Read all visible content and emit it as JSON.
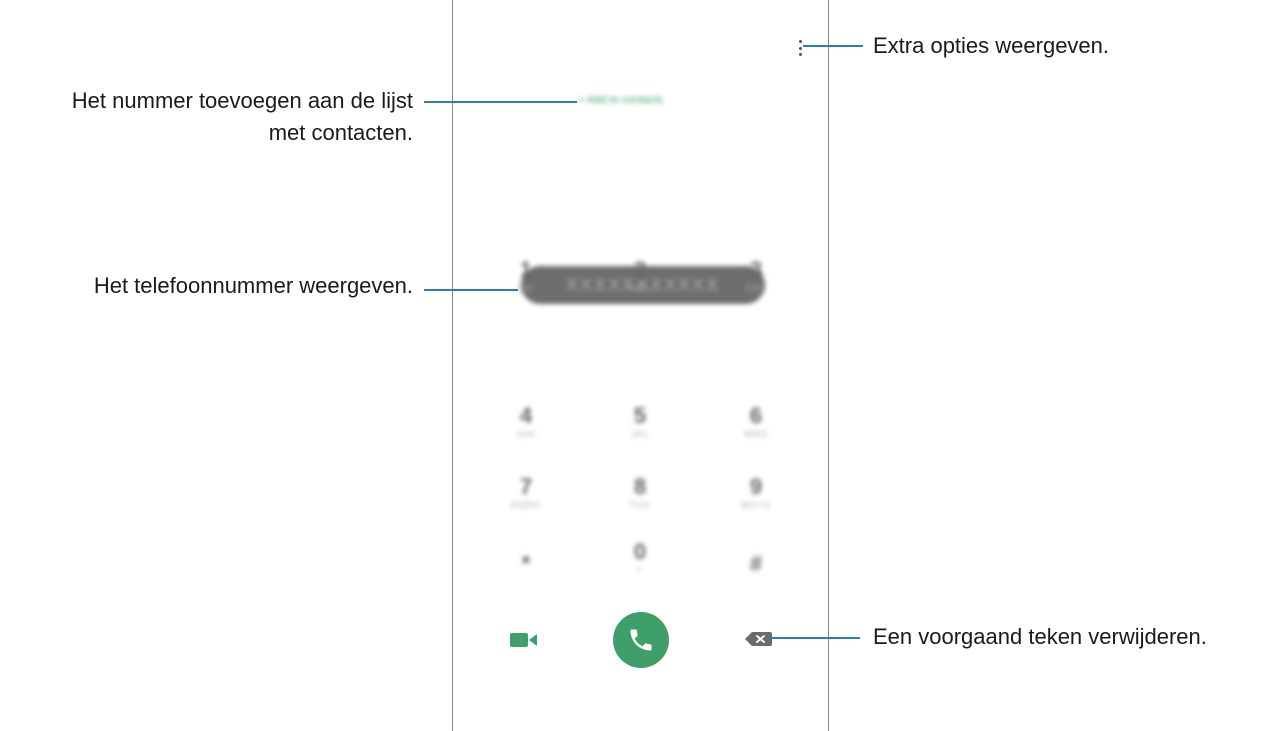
{
  "dialer": {
    "add_contact_label": "+ Add to contacts",
    "phone_number": "XXXXXXXXXXX",
    "keys": [
      {
        "num": "1",
        "sub": "QO"
      },
      {
        "num": "2",
        "sub": "ABC"
      },
      {
        "num": "3",
        "sub": "DEF"
      },
      {
        "num": "4",
        "sub": "GHI"
      },
      {
        "num": "5",
        "sub": "JKL"
      },
      {
        "num": "6",
        "sub": "MNO"
      },
      {
        "num": "7",
        "sub": "PQRS"
      },
      {
        "num": "8",
        "sub": "TUV"
      },
      {
        "num": "9",
        "sub": "WXYZ"
      },
      {
        "num": "*",
        "sub": ""
      },
      {
        "num": "0",
        "sub": "+"
      },
      {
        "num": "#",
        "sub": ""
      }
    ],
    "accent_color": "#3f9f68"
  },
  "callouts": {
    "more_options": "Extra opties weergeven.",
    "add_to_contacts_line1": "Het nummer toevoegen aan de lijst",
    "add_to_contacts_line2": "met contacten.",
    "view_number": "Het telefoonnummer weergeven.",
    "delete_char": "Een voorgaand teken verwijderen.",
    "line_color": "#2b7fae"
  }
}
